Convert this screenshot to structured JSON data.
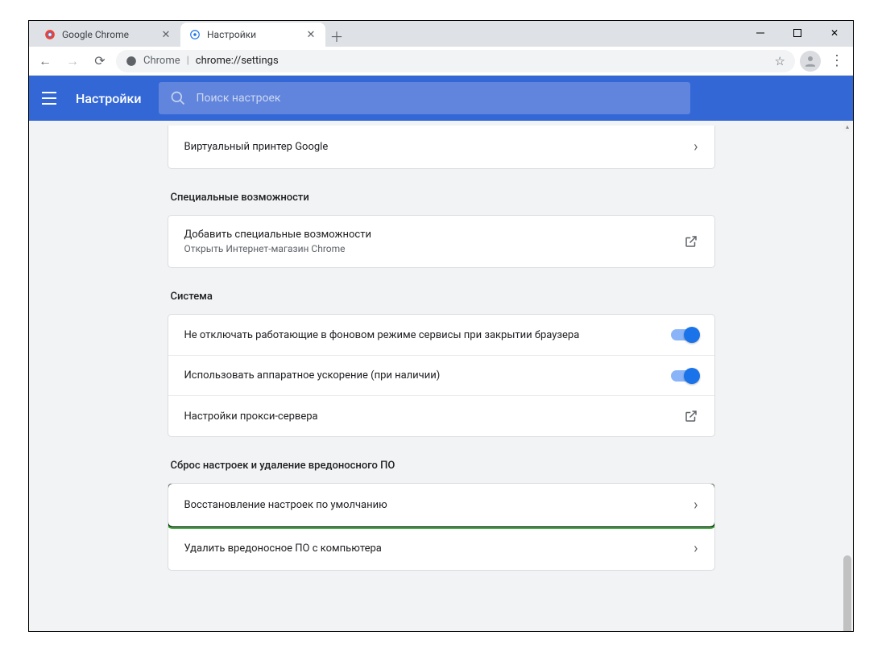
{
  "window": {
    "tabs": [
      {
        "title": "Google Chrome",
        "active": false
      },
      {
        "title": "Настройки",
        "active": true
      }
    ]
  },
  "addressbar": {
    "host": "Chrome",
    "path": "chrome://settings"
  },
  "header": {
    "title": "Настройки",
    "search_placeholder": "Поиск настроек"
  },
  "sections": {
    "print_row": "Виртуальный принтер Google",
    "accessibility": {
      "title": "Специальные возможности",
      "row_title": "Добавить специальные возможности",
      "row_sub": "Открыть Интернет-магазин Chrome"
    },
    "system": {
      "title": "Система",
      "row_bg": "Не отключать работающие в фоновом режиме сервисы при закрытии браузера",
      "row_hw": "Использовать аппаратное ускорение (при наличии)",
      "row_proxy": "Настройки прокси-сервера"
    },
    "reset": {
      "title": "Сброс настроек и удаление вредоносного ПО",
      "row_restore": "Восстановление настроек по умолчанию",
      "row_cleanup": "Удалить вредоносное ПО с компьютера"
    }
  }
}
